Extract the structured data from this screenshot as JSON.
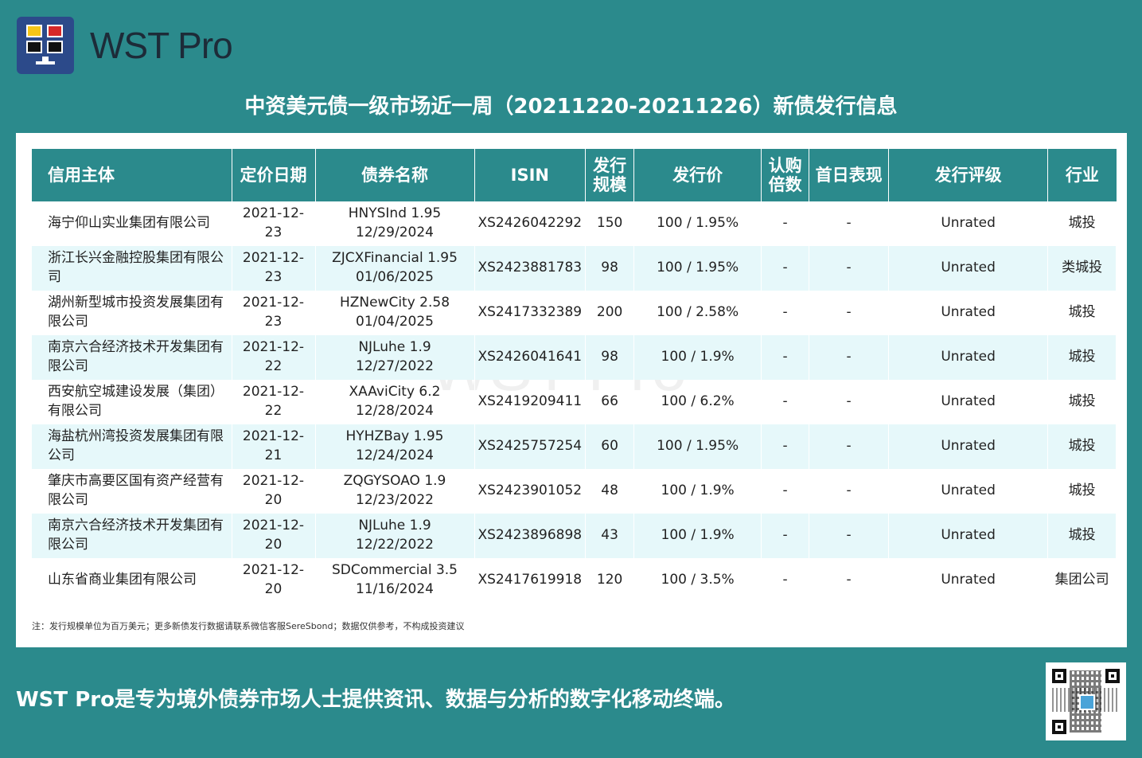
{
  "brand": {
    "name": "WST Pro"
  },
  "title": "中资美元债一级市场近一周（20211220-20211226）新债发行信息",
  "table": {
    "headers": [
      "信用主体",
      "定价日期",
      "债券名称",
      "ISIN",
      "发行规模",
      "发行价",
      "认购倍数",
      "首日表现",
      "发行评级",
      "行业"
    ],
    "rows": [
      {
        "issuer": "海宁仰山实业集团有限公司",
        "date": "2021-12-23",
        "bond": "HNYSInd 1.95 12/29/2024",
        "isin": "XS2426042292",
        "size": "150",
        "price": "100 / 1.95%",
        "subscription": "-",
        "first_day": "-",
        "rating": "Unrated",
        "industry": "城投"
      },
      {
        "issuer": "浙江长兴金融控股集团有限公司",
        "date": "2021-12-23",
        "bond": "ZJCXFinancial 1.95 01/06/2025",
        "isin": "XS2423881783",
        "size": "98",
        "price": "100 / 1.95%",
        "subscription": "-",
        "first_day": "-",
        "rating": "Unrated",
        "industry": "类城投"
      },
      {
        "issuer": "湖州新型城市投资发展集团有限公司",
        "date": "2021-12-23",
        "bond": "HZNewCity 2.58 01/04/2025",
        "isin": "XS2417332389",
        "size": "200",
        "price": "100 / 2.58%",
        "subscription": "-",
        "first_day": "-",
        "rating": "Unrated",
        "industry": "城投"
      },
      {
        "issuer": "南京六合经济技术开发集团有限公司",
        "date": "2021-12-22",
        "bond": "NJLuhe 1.9 12/27/2022",
        "isin": "XS2426041641",
        "size": "98",
        "price": "100 / 1.9%",
        "subscription": "-",
        "first_day": "-",
        "rating": "Unrated",
        "industry": "城投"
      },
      {
        "issuer": "西安航空城建设发展（集团）有限公司",
        "date": "2021-12-22",
        "bond": "XAAviCity 6.2 12/28/2024",
        "isin": "XS2419209411",
        "size": "66",
        "price": "100 / 6.2%",
        "subscription": "-",
        "first_day": "-",
        "rating": "Unrated",
        "industry": "城投"
      },
      {
        "issuer": "海盐杭州湾投资发展集团有限公司",
        "date": "2021-12-21",
        "bond": "HYHZBay 1.95 12/24/2024",
        "isin": "XS2425757254",
        "size": "60",
        "price": "100 / 1.95%",
        "subscription": "-",
        "first_day": "-",
        "rating": "Unrated",
        "industry": "城投"
      },
      {
        "issuer": "肇庆市高要区国有资产经营有限公司",
        "date": "2021-12-20",
        "bond": "ZQGYSOAO 1.9 12/23/2022",
        "isin": "XS2423901052",
        "size": "48",
        "price": "100 / 1.9%",
        "subscription": "-",
        "first_day": "-",
        "rating": "Unrated",
        "industry": "城投"
      },
      {
        "issuer": "南京六合经济技术开发集团有限公司",
        "date": "2021-12-20",
        "bond": "NJLuhe 1.9 12/22/2022",
        "isin": "XS2423896898",
        "size": "43",
        "price": "100 / 1.9%",
        "subscription": "-",
        "first_day": "-",
        "rating": "Unrated",
        "industry": "城投"
      },
      {
        "issuer": "山东省商业集团有限公司",
        "date": "2021-12-20",
        "bond": "SDCommercial 3.5 11/16/2024",
        "isin": "XS2417619918",
        "size": "120",
        "price": "100 / 3.5%",
        "subscription": "-",
        "first_day": "-",
        "rating": "Unrated",
        "industry": "集团公司"
      }
    ]
  },
  "note": "注：发行规模单位为百万美元；更多新债发行数据请联系微信客服SereSbond；数据仅供参考，不构成投资建议",
  "footer": "WST Pro是专为境外债券市场人士提供资讯、数据与分析的数字化移动终端。",
  "colors": {
    "background": "#2b8a8c",
    "header": "#2b8a8c",
    "row_alt": "#e6f8fa",
    "logo": "#2c4a8a"
  }
}
